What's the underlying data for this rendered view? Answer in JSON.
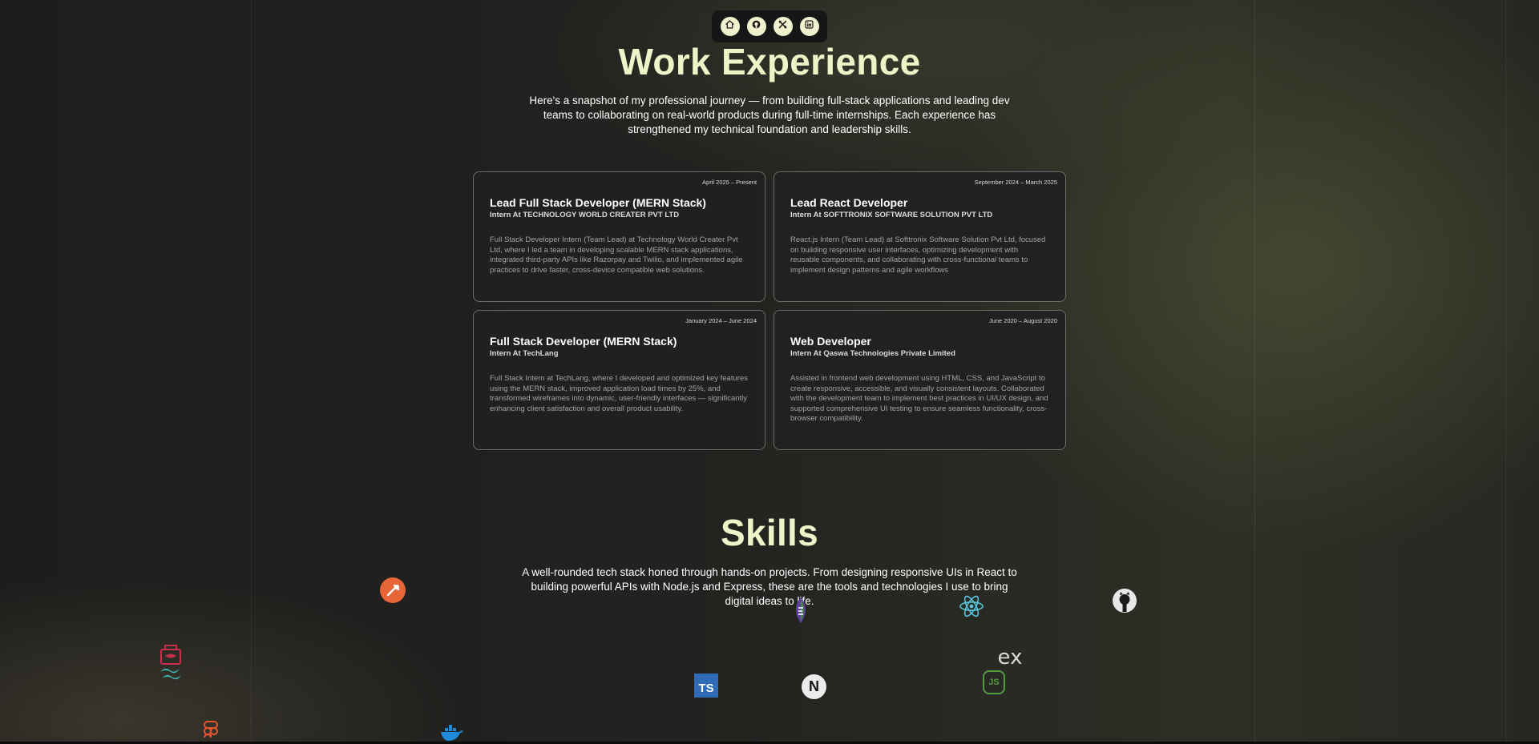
{
  "nav": {
    "items": [
      {
        "name": "home-icon"
      },
      {
        "name": "github-icon"
      },
      {
        "name": "tools-icon"
      },
      {
        "name": "linkedin-icon"
      }
    ]
  },
  "experience": {
    "title": "Work Experience",
    "intro": "Here's a snapshot of my professional journey — from building full-stack applications and leading dev teams to collaborating on real-world products during full-time internships. Each experience has strengthened my technical foundation and leadership skills.",
    "jobs": [
      {
        "date": "April 2025 – Present",
        "role": "Lead Full Stack Developer (MERN Stack)",
        "company": "Intern At TECHNOLOGY WORLD CREATER PVT LTD",
        "description": "Full Stack Developer Intern (Team Lead) at Technology World Creater Pvt Ltd, where I led a team in developing scalable MERN stack applications, integrated third-party APIs like Razorpay and Twilio, and implemented agile practices to drive faster, cross-device compatible web solutions."
      },
      {
        "date": "September 2024 – March 2025",
        "role": "Lead React Developer",
        "company": "Intern At SOFTTRONIX SOFTWARE SOLUTION PVT LTD",
        "description": "React.js Intern (Team Lead) at Softtronix Software Solution Pvt Ltd, focused on building responsive user interfaces, optimizing development with reusable components, and collaborating with cross-functional teams to implement design patterns and agile workflows"
      },
      {
        "date": "January 2024 – June 2024",
        "role": "Full Stack Developer (MERN Stack)",
        "company": "Intern At TechLang",
        "description": "Full Stack Intern at TechLang, where I developed and optimized key features using the MERN stack, improved application load times by 25%, and transformed wireframes into dynamic, user-friendly interfaces — significantly enhancing client satisfaction and overall product usability."
      },
      {
        "date": "June 2020 – August 2020",
        "role": "Web Developer",
        "company": "Intern At Qaswa Technologies Private Limited",
        "description": "Assisted in frontend web development using HTML, CSS, and JavaScript to create responsive, accessible, and visually consistent layouts. Collaborated with the development team to implement best practices in UI/UX design, and supported comprehensive UI testing to ensure seamless functionality, cross-browser compatibility."
      }
    ]
  },
  "skills": {
    "title": "Skills",
    "intro": "A well-rounded tech stack honed through hands-on projects. From designing responsive UIs in React to building powerful APIs with Node.js and Express, these are the tools and technologies I use to bring digital ideas to life.",
    "icons": {
      "postman": "postman-icon",
      "mongodb": "mongodb-icon",
      "react": "react-icon",
      "github": "github-icon",
      "sass": "sass-icon",
      "tailwind": "tailwind-icon",
      "express": "express-icon",
      "express_label": "ex",
      "typescript": "typescript-icon",
      "typescript_label": "TS",
      "nextjs": "nextjs-icon",
      "nextjs_label": "N",
      "nodejs": "nodejs-icon",
      "nodejs_label": "JS",
      "figma": "figma-icon",
      "docker": "docker-icon"
    }
  },
  "colors": {
    "heading": "#eff3c8",
    "accent_button": "#f0f2cf",
    "card_bg": "#212121"
  }
}
